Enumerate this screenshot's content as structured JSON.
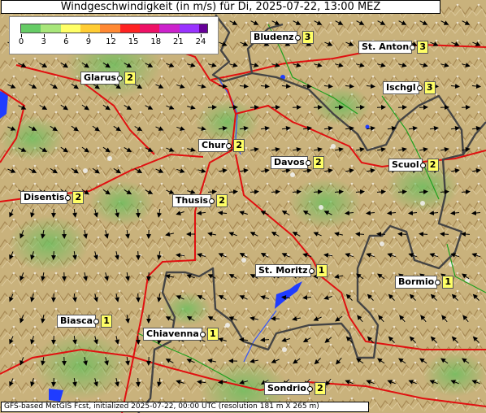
{
  "title": "Windgeschwindigkeit (in m/s) für Di, 2025-07-22, 13:00 MEZ",
  "legend": {
    "ticks": [
      "0",
      "3",
      "6",
      "9",
      "12",
      "15",
      "18",
      "21",
      "24"
    ],
    "colors": [
      "#66cc66",
      "#a8e67a",
      "#ffff66",
      "#ffcc33",
      "#ff8833",
      "#ff2222",
      "#ee1166",
      "#cc22cc",
      "#9933ff",
      "#660099"
    ]
  },
  "stations": [
    {
      "name": "Bludenz",
      "value": "3"
    },
    {
      "name": "St. Anton",
      "value": "3"
    },
    {
      "name": "Glarus",
      "value": "2"
    },
    {
      "name": "Ischgl",
      "value": "3"
    },
    {
      "name": "Chur",
      "value": "2"
    },
    {
      "name": "Davos",
      "value": "2"
    },
    {
      "name": "Scuol",
      "value": "2"
    },
    {
      "name": "Disentis",
      "value": "2"
    },
    {
      "name": "Thusis",
      "value": "2"
    },
    {
      "name": "St. Moritz",
      "value": "1"
    },
    {
      "name": "Bormio",
      "value": "1"
    },
    {
      "name": "Biasca",
      "value": "1"
    },
    {
      "name": "Chiavenna",
      "value": "1"
    },
    {
      "name": "Sondrio",
      "value": "2"
    }
  ],
  "footer": "GFS-based MetGIS Fcst, initialized 2025-07-22, 00:00 UTC  (resolution 181 m X 265 m)"
}
